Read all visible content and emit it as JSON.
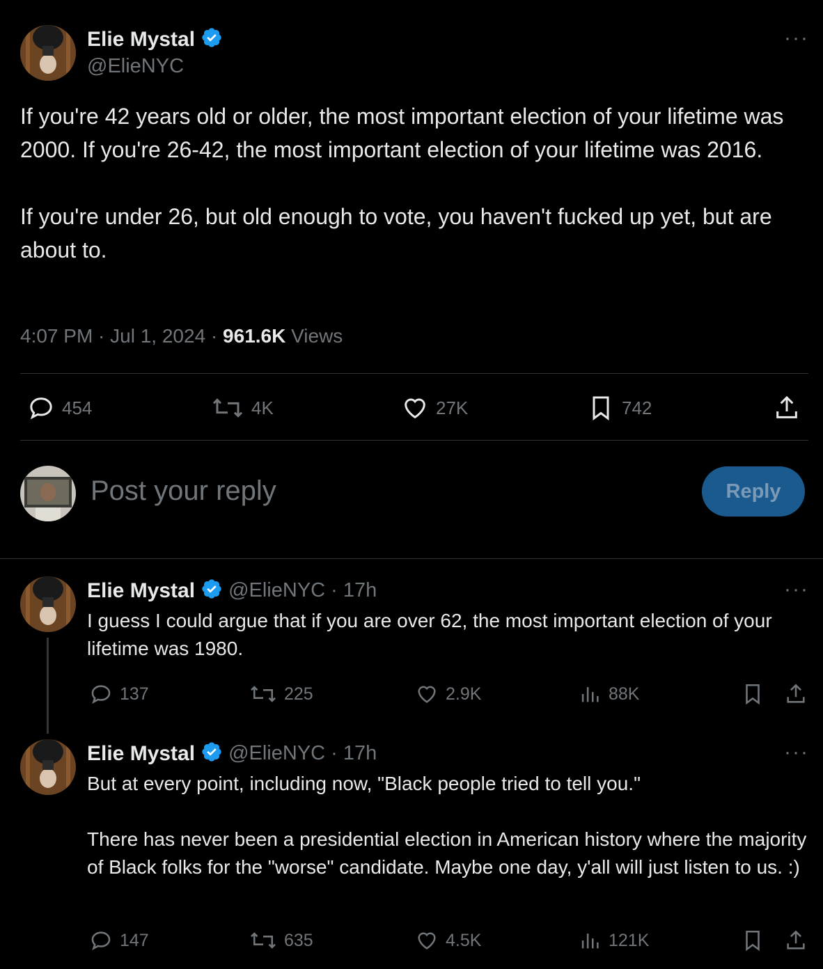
{
  "main_tweet": {
    "author_name": "Elie Mystal",
    "handle": "@ElieNYC",
    "more": "···",
    "text": "If you're 42 years old or older, the most important election of your lifetime was 2000. If you're 26-42, the most important election of your lifetime was 2016.\n\nIf you're under 26, but old enough to vote, you haven't fucked up yet, but are about to.",
    "time": "4:07 PM · Jul 1, 2024 · ",
    "views_count": "961.6K",
    "views_label": " Views",
    "stats": {
      "replies": "454",
      "retweets": "4K",
      "likes": "27K",
      "bookmarks": "742"
    }
  },
  "compose": {
    "placeholder": "Post your reply",
    "button_label": "Reply"
  },
  "replies": [
    {
      "author_name": "Elie Mystal",
      "handle_time": "@ElieNYC · 17h",
      "more": "···",
      "text": "I guess I could argue that if you are over 62, the most important election of your lifetime was 1980.",
      "stats": {
        "replies": "137",
        "retweets": "225",
        "likes": "2.9K",
        "views": "88K"
      }
    },
    {
      "author_name": "Elie Mystal",
      "handle_time": "@ElieNYC · 17h",
      "more": "···",
      "text": "But at every point, including now, \"Black people tried to tell you.\"\n\nThere has never been a presidential election in American history where the majority of Black folks for the \"worse\" candidate. Maybe one day, y'all will just listen to us. :)",
      "stats": {
        "replies": "147",
        "retweets": "635",
        "likes": "4.5K",
        "views": "121K"
      }
    }
  ],
  "colors": {
    "background": "#000000",
    "text": "#e7e9ea",
    "muted": "#71767b",
    "verified": "#1d9bf0",
    "reply_button": "#1a5a8e"
  }
}
